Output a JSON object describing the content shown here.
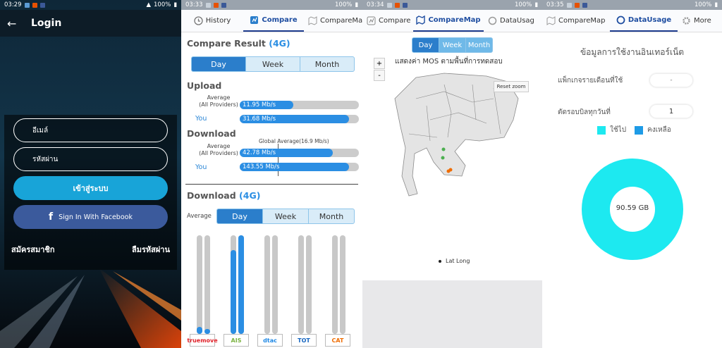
{
  "login": {
    "status_time": "03:29",
    "battery": "100%",
    "title": "Login",
    "username_placeholder": "อีเมล์",
    "password_placeholder": "รหัสผ่าน",
    "login_button": "เข้าสู่ระบบ",
    "facebook_button": "Sign In With Facebook",
    "register_link": "สมัครสมาชิก",
    "forgot_link": "ลืมรหัสผ่าน"
  },
  "compare": {
    "status_time": "03:33",
    "battery": "100%",
    "tabs": [
      "History",
      "Compare",
      "CompareMa"
    ],
    "result_title": "Compare Result",
    "result_net": "(4G)",
    "periods": [
      "Day",
      "Week",
      "Month"
    ],
    "upload_title": "Upload",
    "average_label": "Average",
    "all_providers": "(All Providers)",
    "you_label": "You",
    "upload_avg": "11.95 Mb/s",
    "upload_you": "31.68 Mb/s",
    "upload_avg_pct": 0.45,
    "upload_you_pct": 0.92,
    "download_title": "Download",
    "global_label": "Global Average(16.9 Mb/s)",
    "download_avg": "42.78 Mb/s",
    "download_you": "143.55 Mb/s",
    "download_avg_pct": 0.78,
    "download_you_pct": 0.92,
    "download4g_title": "Download",
    "download4g_net": "(4G)",
    "average_short": "Average",
    "provider_bars": [
      {
        "name": "truemove",
        "avg": 0.07,
        "you": 0.05,
        "color": "#e0222a"
      },
      {
        "name": "AIS",
        "avg": 0.85,
        "you": 1.0,
        "color": "#7cb342"
      },
      {
        "name": "dtac",
        "avg": 0.0,
        "you": 0.0,
        "color": "#1e88e5"
      },
      {
        "name": "TOT",
        "avg": 0.0,
        "you": 0.0,
        "color": "#1565c0"
      },
      {
        "name": "CAT",
        "avg": 0.0,
        "you": 0.0,
        "color": "#ef6c00"
      }
    ]
  },
  "map": {
    "status_time": "03:34",
    "battery": "100%",
    "tabs": [
      "Compare",
      "CompareMap",
      "DataUsag"
    ],
    "periods": [
      "Day",
      "Week",
      "Month"
    ],
    "zoom_in": "+",
    "zoom_out": "-",
    "map_title": "แสดงค่า MOS ตามพื้นที่การทดสอบ",
    "reset_zoom": "Reset zoom",
    "legend_label": "Lat Long"
  },
  "usage": {
    "status_time": "03:35",
    "battery": "100%",
    "tabs": [
      "CompareMap",
      "DataUsage",
      "More"
    ],
    "title": "ข้อมูลการใช้งานอินเทอร์เน็ต",
    "package_label": "แพ็กเกจรายเดือนที่ใช้",
    "package_value": "-",
    "billing_label": "ตัดรอบบิลทุกวันที่",
    "billing_value": "1",
    "used_label": "ใช้ไป",
    "remaining_label": "คงเหลือ",
    "used_color": "#1de9f0",
    "remaining_color": "#1e9be6",
    "donut_value": "90.59 GB"
  }
}
